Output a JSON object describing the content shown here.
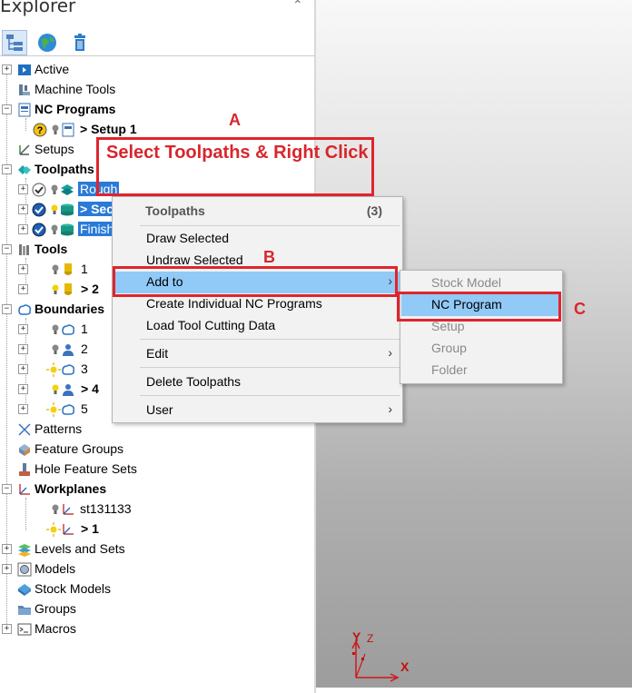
{
  "explorer": {
    "title": "Explorer",
    "collapse_glyph": "⌃",
    "toolbar": [
      {
        "icon": "tree-view-icon",
        "selected": true
      },
      {
        "icon": "globe-icon",
        "selected": false
      },
      {
        "icon": "trash-icon",
        "selected": false
      }
    ]
  },
  "tree": {
    "active": "Active",
    "machine_tools": "Machine Tools",
    "nc_programs": "NC Programs",
    "setup1": "> Setup 1",
    "setups": "Setups",
    "toolpaths": "Toolpaths",
    "tp_rough": "Rough",
    "tp_second": "> Sec",
    "tp_finish": "Finish",
    "tools": "Tools",
    "tool1": "1",
    "tool2": "> 2",
    "boundaries": "Boundaries",
    "b1": "1",
    "b2": "2",
    "b3": "3",
    "b4": "> 4",
    "b5": "5",
    "patterns": "Patterns",
    "feature_groups": "Feature Groups",
    "hole_feature_sets": "Hole Feature Sets",
    "workplanes": "Workplanes",
    "wp1": "st131133",
    "wp2": "> 1",
    "levels": "Levels and Sets",
    "models": "Models",
    "stock_models": "Stock Models",
    "groups": "Groups",
    "macros": "Macros"
  },
  "context_menu": {
    "header": "Toolpaths",
    "count": "(3)",
    "draw_selected": "Draw Selected",
    "undraw_selected": "Undraw Selected",
    "add_to": "Add to",
    "create_individual": "Create Individual NC Programs",
    "load_tool_data": "Load Tool Cutting Data",
    "edit": "Edit",
    "delete_toolpaths": "Delete Toolpaths",
    "user": "User",
    "submenu_arrow": "›"
  },
  "submenu": {
    "stock_model": "Stock Model",
    "nc_program": "NC Program",
    "setup": "Setup",
    "group": "Group",
    "folder": "Folder"
  },
  "annotations": {
    "a": "A",
    "b": "B",
    "c": "C",
    "instruction": "Select Toolpaths & Right Click",
    "color": "#e0242c"
  },
  "axes": {
    "x": "X",
    "y": "Y",
    "z": "Z"
  }
}
